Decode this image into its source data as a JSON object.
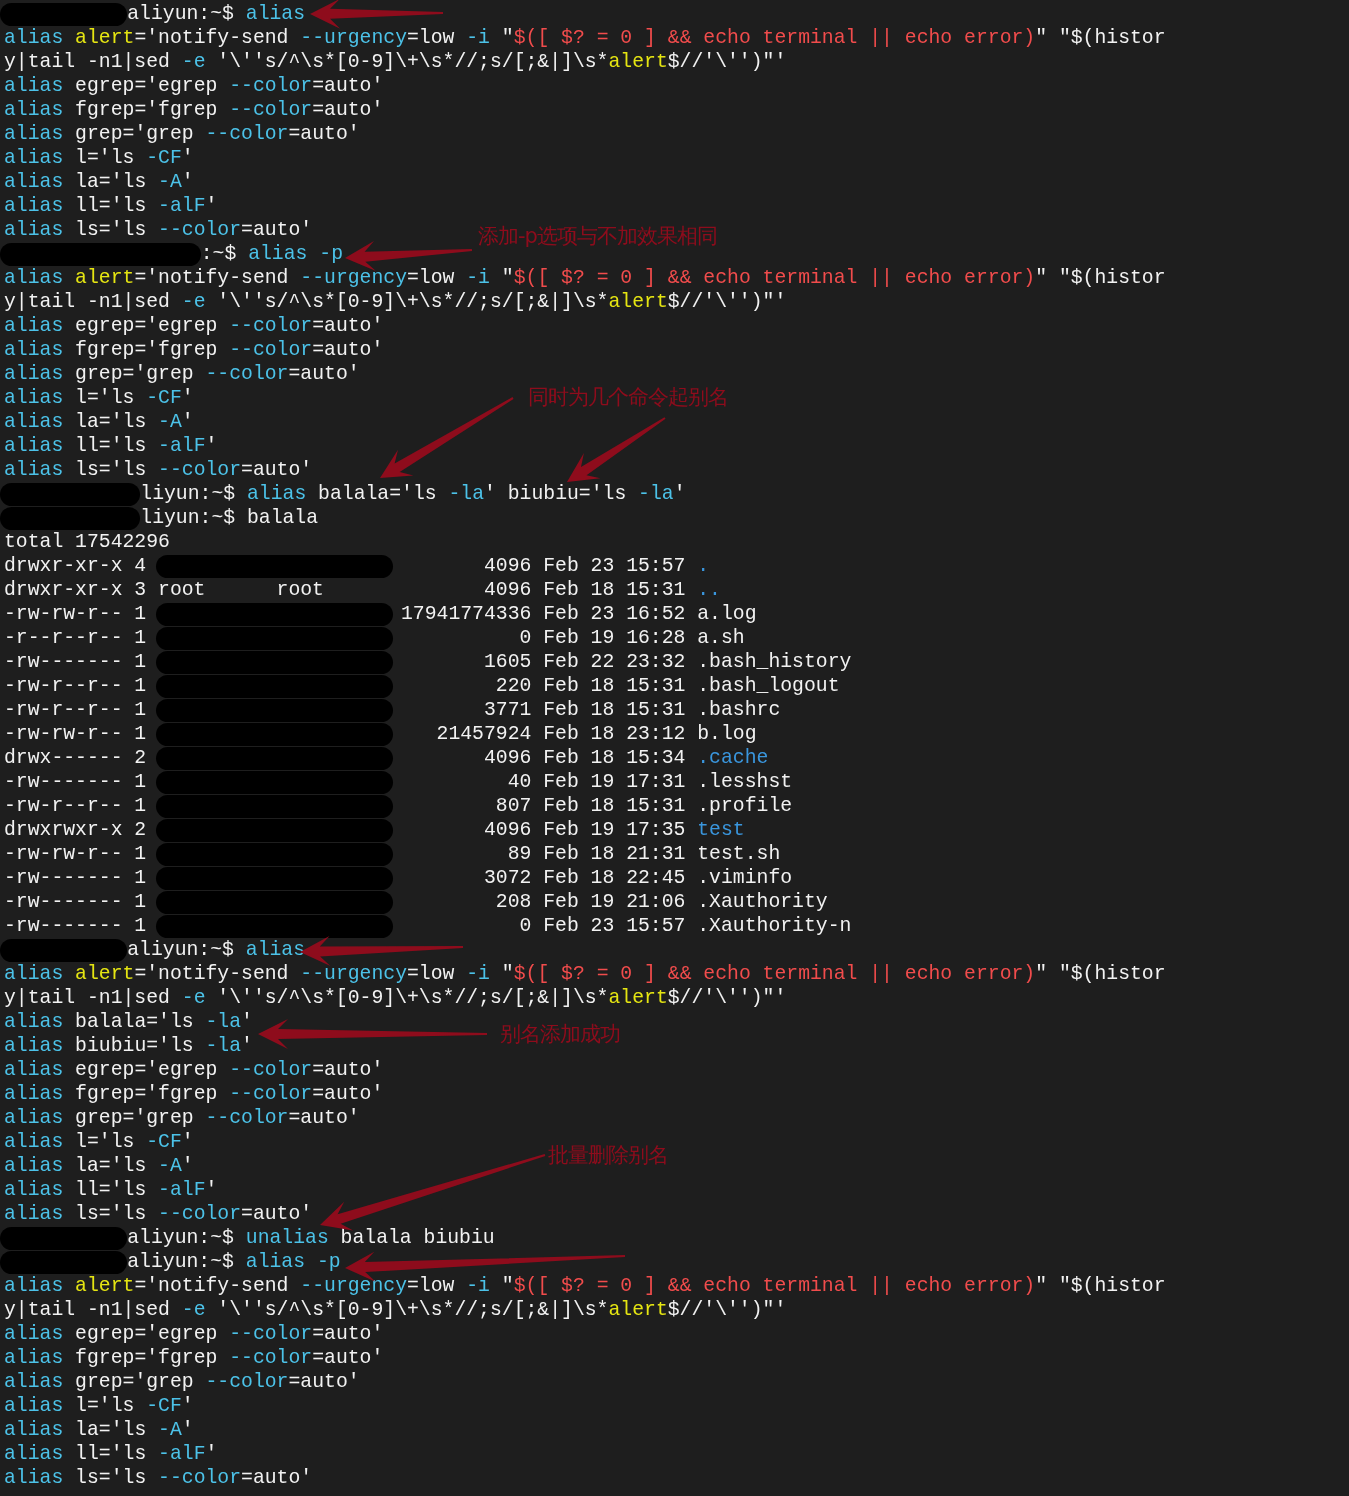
{
  "terminal": {
    "lines": [
      {
        "kind": "prompt",
        "segments": [
          {
            "text": "aliyun:~$ ",
            "kind": "plain"
          },
          {
            "text": "alias",
            "kind": "command"
          }
        ]
      },
      {
        "kind": "text",
        "segments": [
          {
            "text": "alias",
            "kind": "command"
          },
          {
            "text": " alert",
            "kind": "name"
          },
          {
            "text": "='notify-send ",
            "kind": "plain"
          },
          {
            "text": "--urgency",
            "kind": "option"
          },
          {
            "text": "=low ",
            "kind": "plain"
          },
          {
            "text": "-i",
            "kind": "option"
          },
          {
            "text": " \"",
            "kind": "plain"
          },
          {
            "text": "$([ $? = 0 ] && echo terminal || echo error)",
            "kind": "expression"
          },
          {
            "text": "\" \"$(histor",
            "kind": "plain"
          }
        ]
      },
      {
        "kind": "text",
        "segments": [
          {
            "text": "y|tail -n1|sed ",
            "kind": "plain"
          },
          {
            "text": "-e",
            "kind": "option"
          },
          {
            "text": " '\\''s/^\\s*[0-9]\\+\\s*//;s/[;&|]\\s*",
            "kind": "plain"
          },
          {
            "text": "alert",
            "kind": "name"
          },
          {
            "text": "$//'\\'')\"'",
            "kind": "plain"
          }
        ]
      },
      {
        "kind": "text",
        "segments": [
          {
            "text": "alias",
            "kind": "command"
          },
          {
            "text": " egrep='egrep ",
            "kind": "plain"
          },
          {
            "text": "--color",
            "kind": "option"
          },
          {
            "text": "=auto'",
            "kind": "plain"
          }
        ]
      },
      {
        "kind": "text",
        "segments": [
          {
            "text": "alias",
            "kind": "command"
          },
          {
            "text": " fgrep='fgrep ",
            "kind": "plain"
          },
          {
            "text": "--color",
            "kind": "option"
          },
          {
            "text": "=auto'",
            "kind": "plain"
          }
        ]
      },
      {
        "kind": "text",
        "segments": [
          {
            "text": "alias",
            "kind": "command"
          },
          {
            "text": " grep='grep ",
            "kind": "plain"
          },
          {
            "text": "--color",
            "kind": "option"
          },
          {
            "text": "=auto'",
            "kind": "plain"
          }
        ]
      },
      {
        "kind": "text",
        "segments": [
          {
            "text": "alias",
            "kind": "command"
          },
          {
            "text": " l='ls ",
            "kind": "plain"
          },
          {
            "text": "-CF",
            "kind": "option"
          },
          {
            "text": "'",
            "kind": "plain"
          }
        ]
      },
      {
        "kind": "text",
        "segments": [
          {
            "text": "alias",
            "kind": "command"
          },
          {
            "text": " la='ls ",
            "kind": "plain"
          },
          {
            "text": "-A",
            "kind": "option"
          },
          {
            "text": "'",
            "kind": "plain"
          }
        ]
      },
      {
        "kind": "text",
        "segments": [
          {
            "text": "alias",
            "kind": "command"
          },
          {
            "text": " ll='ls ",
            "kind": "plain"
          },
          {
            "text": "-alF",
            "kind": "option"
          },
          {
            "text": "'",
            "kind": "plain"
          }
        ]
      },
      {
        "kind": "text",
        "segments": [
          {
            "text": "alias",
            "kind": "command"
          },
          {
            "text": " ls='ls ",
            "kind": "plain"
          },
          {
            "text": "--color",
            "kind": "option"
          },
          {
            "text": "=auto'",
            "kind": "plain"
          }
        ]
      },
      {
        "kind": "prompt-long",
        "segments": [
          {
            "text": ":~$ ",
            "kind": "plain"
          },
          {
            "text": "alias",
            "kind": "command"
          },
          {
            "text": " -p",
            "kind": "option"
          }
        ]
      },
      {
        "kind": "text",
        "segments": [
          {
            "text": "alias",
            "kind": "command"
          },
          {
            "text": " alert",
            "kind": "name"
          },
          {
            "text": "='notify-send ",
            "kind": "plain"
          },
          {
            "text": "--urgency",
            "kind": "option"
          },
          {
            "text": "=low ",
            "kind": "plain"
          },
          {
            "text": "-i",
            "kind": "option"
          },
          {
            "text": " \"",
            "kind": "plain"
          },
          {
            "text": "$([ $? = 0 ] && echo terminal || echo error)",
            "kind": "expression"
          },
          {
            "text": "\" \"$(histor",
            "kind": "plain"
          }
        ]
      },
      {
        "kind": "text",
        "segments": [
          {
            "text": "y|tail -n1|sed ",
            "kind": "plain"
          },
          {
            "text": "-e",
            "kind": "option"
          },
          {
            "text": " '\\''s/^\\s*[0-9]\\+\\s*//;s/[;&|]\\s*",
            "kind": "plain"
          },
          {
            "text": "alert",
            "kind": "name"
          },
          {
            "text": "$//'\\'')\"'",
            "kind": "plain"
          }
        ]
      },
      {
        "kind": "text",
        "segments": [
          {
            "text": "alias",
            "kind": "command"
          },
          {
            "text": " egrep='egrep ",
            "kind": "plain"
          },
          {
            "text": "--color",
            "kind": "option"
          },
          {
            "text": "=auto'",
            "kind": "plain"
          }
        ]
      },
      {
        "kind": "text",
        "segments": [
          {
            "text": "alias",
            "kind": "command"
          },
          {
            "text": " fgrep='fgrep ",
            "kind": "plain"
          },
          {
            "text": "--color",
            "kind": "option"
          },
          {
            "text": "=auto'",
            "kind": "plain"
          }
        ]
      },
      {
        "kind": "text",
        "segments": [
          {
            "text": "alias",
            "kind": "command"
          },
          {
            "text": " grep='grep ",
            "kind": "plain"
          },
          {
            "text": "--color",
            "kind": "option"
          },
          {
            "text": "=auto'",
            "kind": "plain"
          }
        ]
      },
      {
        "kind": "text",
        "segments": [
          {
            "text": "alias",
            "kind": "command"
          },
          {
            "text": " l='ls ",
            "kind": "plain"
          },
          {
            "text": "-CF",
            "kind": "option"
          },
          {
            "text": "'",
            "kind": "plain"
          }
        ]
      },
      {
        "kind": "text",
        "segments": [
          {
            "text": "alias",
            "kind": "command"
          },
          {
            "text": " la='ls ",
            "kind": "plain"
          },
          {
            "text": "-A",
            "kind": "option"
          },
          {
            "text": "'",
            "kind": "plain"
          }
        ]
      },
      {
        "kind": "text",
        "segments": [
          {
            "text": "alias",
            "kind": "command"
          },
          {
            "text": " ll='ls ",
            "kind": "plain"
          },
          {
            "text": "-alF",
            "kind": "option"
          },
          {
            "text": "'",
            "kind": "plain"
          }
        ]
      },
      {
        "kind": "text",
        "segments": [
          {
            "text": "alias",
            "kind": "command"
          },
          {
            "text": " ls='ls ",
            "kind": "plain"
          },
          {
            "text": "--color",
            "kind": "option"
          },
          {
            "text": "=auto'",
            "kind": "plain"
          }
        ]
      },
      {
        "kind": "prompt-wide",
        "segments": [
          {
            "text": "liyun:~$ ",
            "kind": "plain"
          },
          {
            "text": "alias",
            "kind": "command"
          },
          {
            "text": " balala='ls ",
            "kind": "plain"
          },
          {
            "text": "-la",
            "kind": "option"
          },
          {
            "text": "' biubiu='ls ",
            "kind": "plain"
          },
          {
            "text": "-la",
            "kind": "option"
          },
          {
            "text": "'",
            "kind": "plain"
          }
        ]
      },
      {
        "kind": "prompt-wide",
        "segments": [
          {
            "text": "liyun:~$ balala",
            "kind": "plain"
          }
        ]
      },
      {
        "kind": "text",
        "segments": [
          {
            "text": "total 17542296",
            "kind": "plain"
          }
        ]
      },
      {
        "kind": "dir-entry",
        "perms": "drwxr-xr-x",
        "links": "4",
        "size": "4096",
        "date": "Feb 23 15:57",
        "name": "."
      },
      {
        "kind": "dir-entry",
        "perms": "drwxr-xr-x",
        "links": "3",
        "owner": "root",
        "group": "root",
        "size": "4096",
        "date": "Feb 18 15:31",
        "name": ".."
      },
      {
        "kind": "file-entry",
        "perms": "-rw-rw-r--",
        "links": "1",
        "size": "17941774336",
        "date": "Feb 23 16:52",
        "name": "a.log"
      },
      {
        "kind": "file-entry",
        "perms": "-r--r--r--",
        "links": "1",
        "size": "0",
        "date": "Feb 19 16:28",
        "name": "a.sh"
      },
      {
        "kind": "file-entry",
        "perms": "-rw-------",
        "links": "1",
        "size": "1605",
        "date": "Feb 22 23:32",
        "name": ".bash_history"
      },
      {
        "kind": "file-entry",
        "perms": "-rw-r--r--",
        "links": "1",
        "size": "220",
        "date": "Feb 18 15:31",
        "name": ".bash_logout"
      },
      {
        "kind": "file-entry",
        "perms": "-rw-r--r--",
        "links": "1",
        "size": "3771",
        "date": "Feb 18 15:31",
        "name": ".bashrc"
      },
      {
        "kind": "file-entry",
        "perms": "-rw-rw-r--",
        "links": "1",
        "size": "21457924",
        "date": "Feb 18 23:12",
        "name": "b.log"
      },
      {
        "kind": "dir-entry",
        "perms": "drwx------",
        "links": "2",
        "size": "4096",
        "date": "Feb 18 15:34",
        "name": ".cache"
      },
      {
        "kind": "file-entry",
        "perms": "-rw-------",
        "links": "1",
        "size": "40",
        "date": "Feb 19 17:31",
        "name": ".lesshst"
      },
      {
        "kind": "file-entry",
        "perms": "-rw-r--r--",
        "links": "1",
        "size": "807",
        "date": "Feb 18 15:31",
        "name": ".profile"
      },
      {
        "kind": "dir-entry",
        "perms": "drwxrwxr-x",
        "links": "2",
        "size": "4096",
        "date": "Feb 19 17:35",
        "name": "test"
      },
      {
        "kind": "file-entry",
        "perms": "-rw-rw-r--",
        "links": "1",
        "size": "89",
        "date": "Feb 18 21:31",
        "name": "test.sh"
      },
      {
        "kind": "file-entry",
        "perms": "-rw-------",
        "links": "1",
        "size": "3072",
        "date": "Feb 18 22:45",
        "name": ".viminfo"
      },
      {
        "kind": "file-entry",
        "perms": "-rw-------",
        "links": "1",
        "size": "208",
        "date": "Feb 19 21:06",
        "name": ".Xauthority"
      },
      {
        "kind": "file-entry",
        "perms": "-rw-------",
        "links": "1",
        "size": "0",
        "date": "Feb 23 15:57",
        "name": ".Xauthority-n"
      },
      {
        "kind": "prompt",
        "segments": [
          {
            "text": "aliyun:~$ ",
            "kind": "plain"
          },
          {
            "text": "alias",
            "kind": "command"
          }
        ]
      },
      {
        "kind": "text",
        "segments": [
          {
            "text": "alias",
            "kind": "command"
          },
          {
            "text": " alert",
            "kind": "name"
          },
          {
            "text": "='notify-send ",
            "kind": "plain"
          },
          {
            "text": "--urgency",
            "kind": "option"
          },
          {
            "text": "=low ",
            "kind": "plain"
          },
          {
            "text": "-i",
            "kind": "option"
          },
          {
            "text": " \"",
            "kind": "plain"
          },
          {
            "text": "$([ $? = 0 ] && echo terminal || echo error)",
            "kind": "expression"
          },
          {
            "text": "\" \"$(histor",
            "kind": "plain"
          }
        ]
      },
      {
        "kind": "text",
        "segments": [
          {
            "text": "y|tail -n1|sed ",
            "kind": "plain"
          },
          {
            "text": "-e",
            "kind": "option"
          },
          {
            "text": " '\\''s/^\\s*[0-9]\\+\\s*//;s/[;&|]\\s*",
            "kind": "plain"
          },
          {
            "text": "alert",
            "kind": "name"
          },
          {
            "text": "$//'\\'')\"'",
            "kind": "plain"
          }
        ]
      },
      {
        "kind": "text",
        "segments": [
          {
            "text": "alias",
            "kind": "command"
          },
          {
            "text": " balala='ls ",
            "kind": "plain"
          },
          {
            "text": "-la",
            "kind": "option"
          },
          {
            "text": "'",
            "kind": "plain"
          }
        ]
      },
      {
        "kind": "text",
        "segments": [
          {
            "text": "alias",
            "kind": "command"
          },
          {
            "text": " biubiu='ls ",
            "kind": "plain"
          },
          {
            "text": "-la",
            "kind": "option"
          },
          {
            "text": "'",
            "kind": "plain"
          }
        ]
      },
      {
        "kind": "text",
        "segments": [
          {
            "text": "alias",
            "kind": "command"
          },
          {
            "text": " egrep='egrep ",
            "kind": "plain"
          },
          {
            "text": "--color",
            "kind": "option"
          },
          {
            "text": "=auto'",
            "kind": "plain"
          }
        ]
      },
      {
        "kind": "text",
        "segments": [
          {
            "text": "alias",
            "kind": "command"
          },
          {
            "text": " fgrep='fgrep ",
            "kind": "plain"
          },
          {
            "text": "--color",
            "kind": "option"
          },
          {
            "text": "=auto'",
            "kind": "plain"
          }
        ]
      },
      {
        "kind": "text",
        "segments": [
          {
            "text": "alias",
            "kind": "command"
          },
          {
            "text": " grep='grep ",
            "kind": "plain"
          },
          {
            "text": "--color",
            "kind": "option"
          },
          {
            "text": "=auto'",
            "kind": "plain"
          }
        ]
      },
      {
        "kind": "text",
        "segments": [
          {
            "text": "alias",
            "kind": "command"
          },
          {
            "text": " l='ls ",
            "kind": "plain"
          },
          {
            "text": "-CF",
            "kind": "option"
          },
          {
            "text": "'",
            "kind": "plain"
          }
        ]
      },
      {
        "kind": "text",
        "segments": [
          {
            "text": "alias",
            "kind": "command"
          },
          {
            "text": " la='ls ",
            "kind": "plain"
          },
          {
            "text": "-A",
            "kind": "option"
          },
          {
            "text": "'",
            "kind": "plain"
          }
        ]
      },
      {
        "kind": "text",
        "segments": [
          {
            "text": "alias",
            "kind": "command"
          },
          {
            "text": " ll='ls ",
            "kind": "plain"
          },
          {
            "text": "-alF",
            "kind": "option"
          },
          {
            "text": "'",
            "kind": "plain"
          }
        ]
      },
      {
        "kind": "text",
        "segments": [
          {
            "text": "alias",
            "kind": "command"
          },
          {
            "text": " ls='ls ",
            "kind": "plain"
          },
          {
            "text": "--color",
            "kind": "option"
          },
          {
            "text": "=auto'",
            "kind": "plain"
          }
        ]
      },
      {
        "kind": "prompt",
        "segments": [
          {
            "text": "aliyun:~$ ",
            "kind": "plain"
          },
          {
            "text": "unalias",
            "kind": "command"
          },
          {
            "text": " balala biubiu",
            "kind": "plain"
          }
        ]
      },
      {
        "kind": "prompt",
        "segments": [
          {
            "text": "aliyun:~$ ",
            "kind": "plain"
          },
          {
            "text": "alias",
            "kind": "command"
          },
          {
            "text": " -p",
            "kind": "option"
          }
        ]
      },
      {
        "kind": "text",
        "segments": [
          {
            "text": "alias",
            "kind": "command"
          },
          {
            "text": " alert",
            "kind": "name"
          },
          {
            "text": "='notify-send ",
            "kind": "plain"
          },
          {
            "text": "--urgency",
            "kind": "option"
          },
          {
            "text": "=low ",
            "kind": "plain"
          },
          {
            "text": "-i",
            "kind": "option"
          },
          {
            "text": " \"",
            "kind": "plain"
          },
          {
            "text": "$([ $? = 0 ] && echo terminal || echo error)",
            "kind": "expression"
          },
          {
            "text": "\" \"$(histor",
            "kind": "plain"
          }
        ]
      },
      {
        "kind": "text",
        "segments": [
          {
            "text": "y|tail -n1|sed ",
            "kind": "plain"
          },
          {
            "text": "-e",
            "kind": "option"
          },
          {
            "text": " '\\''s/^\\s*[0-9]\\+\\s*//;s/[;&|]\\s*",
            "kind": "plain"
          },
          {
            "text": "alert",
            "kind": "name"
          },
          {
            "text": "$//'\\'')\"'",
            "kind": "plain"
          }
        ]
      },
      {
        "kind": "text",
        "segments": [
          {
            "text": "alias",
            "kind": "command"
          },
          {
            "text": " egrep='egrep ",
            "kind": "plain"
          },
          {
            "text": "--color",
            "kind": "option"
          },
          {
            "text": "=auto'",
            "kind": "plain"
          }
        ]
      },
      {
        "kind": "text",
        "segments": [
          {
            "text": "alias",
            "kind": "command"
          },
          {
            "text": " fgrep='fgrep ",
            "kind": "plain"
          },
          {
            "text": "--color",
            "kind": "option"
          },
          {
            "text": "=auto'",
            "kind": "plain"
          }
        ]
      },
      {
        "kind": "text",
        "segments": [
          {
            "text": "alias",
            "kind": "command"
          },
          {
            "text": " grep='grep ",
            "kind": "plain"
          },
          {
            "text": "--color",
            "kind": "option"
          },
          {
            "text": "=auto'",
            "kind": "plain"
          }
        ]
      },
      {
        "kind": "text",
        "segments": [
          {
            "text": "alias",
            "kind": "command"
          },
          {
            "text": " l='ls ",
            "kind": "plain"
          },
          {
            "text": "-CF",
            "kind": "option"
          },
          {
            "text": "'",
            "kind": "plain"
          }
        ]
      },
      {
        "kind": "text",
        "segments": [
          {
            "text": "alias",
            "kind": "command"
          },
          {
            "text": " la='ls ",
            "kind": "plain"
          },
          {
            "text": "-A",
            "kind": "option"
          },
          {
            "text": "'",
            "kind": "plain"
          }
        ]
      },
      {
        "kind": "text",
        "segments": [
          {
            "text": "alias",
            "kind": "command"
          },
          {
            "text": " ll='ls ",
            "kind": "plain"
          },
          {
            "text": "-alF",
            "kind": "option"
          },
          {
            "text": "'",
            "kind": "plain"
          }
        ]
      },
      {
        "kind": "text",
        "segments": [
          {
            "text": "alias",
            "kind": "command"
          },
          {
            "text": " ls='ls ",
            "kind": "plain"
          },
          {
            "text": "--color",
            "kind": "option"
          },
          {
            "text": "=auto'",
            "kind": "plain"
          }
        ]
      }
    ]
  },
  "annotations": [
    {
      "text": "添加-p选项与不加效果相同"
    },
    {
      "text": "同时为几个命令起别名"
    },
    {
      "text": "别名添加成功"
    },
    {
      "text": "批量删除别名"
    }
  ]
}
